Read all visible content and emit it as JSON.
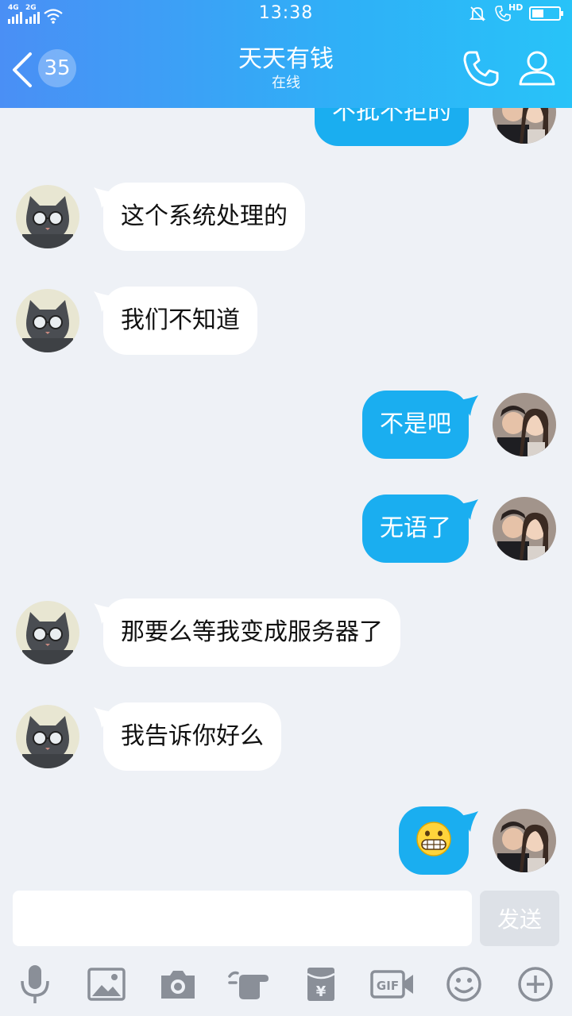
{
  "status_bar": {
    "time": "13:38",
    "network_1": "4G",
    "network_2": "2G",
    "hd": "HD"
  },
  "header": {
    "unread_count": "35",
    "contact_name": "天天有钱",
    "contact_status": "在线"
  },
  "messages": [
    {
      "side": "right",
      "type": "text",
      "text": "不批不拒的"
    },
    {
      "side": "left",
      "type": "text",
      "text": "这个系统处理的"
    },
    {
      "side": "left",
      "type": "text",
      "text": "我们不知道"
    },
    {
      "side": "right",
      "type": "text",
      "text": "不是吧"
    },
    {
      "side": "right",
      "type": "text",
      "text": "无语了"
    },
    {
      "side": "left",
      "type": "text",
      "text": "那要么等我变成服务器了"
    },
    {
      "side": "left",
      "type": "text",
      "text": "我告诉你好么"
    },
    {
      "side": "right",
      "type": "emoji",
      "emoji": "grimacing-face"
    }
  ],
  "input": {
    "value": "",
    "placeholder": "",
    "send_label": "发送"
  },
  "toolbar": {
    "items": [
      "microphone-icon",
      "image-icon",
      "camera-icon",
      "poke-hand-icon",
      "red-packet-icon",
      "gif-icon",
      "emoji-icon",
      "plus-icon"
    ],
    "gif_label": "GIF",
    "red_packet_symbol": "¥"
  },
  "colors": {
    "header_gradient_start": "#4a8ff5",
    "header_gradient_end": "#28c3f8",
    "outgoing_bubble": "#1aaef0",
    "incoming_bubble": "#ffffff",
    "background": "#eef1f6",
    "icon_gray": "#8a8f98"
  }
}
